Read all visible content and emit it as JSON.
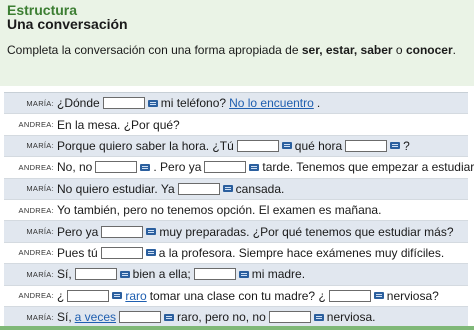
{
  "header": {
    "section_title": "Estructura",
    "subtitle": "Una conversación",
    "instructions": [
      {
        "text": "Completa la conversación con una forma apropiada de ",
        "bold": false
      },
      {
        "text": "ser, estar, saber",
        "bold": true
      },
      {
        "text": " o ",
        "bold": false
      },
      {
        "text": "conocer",
        "bold": true
      },
      {
        "text": ".",
        "bold": false
      }
    ]
  },
  "rows": [
    {
      "speaker": "MARÍA:",
      "parts": [
        {
          "t": "text",
          "v": "¿Dónde"
        },
        {
          "t": "blank",
          "w": 42
        },
        {
          "t": "kbd"
        },
        {
          "t": "text",
          "v": "mi teléfono?"
        },
        {
          "t": "answer",
          "v": "No lo encuentro"
        },
        {
          "t": "text",
          "v": "."
        }
      ]
    },
    {
      "speaker": "ANDREA:",
      "parts": [
        {
          "t": "text",
          "v": "En la mesa. ¿Por qué?"
        }
      ]
    },
    {
      "speaker": "MARÍA:",
      "parts": [
        {
          "t": "text",
          "v": "Porque quiero saber la hora. ¿Tú"
        },
        {
          "t": "blank",
          "w": 42
        },
        {
          "t": "kbd"
        },
        {
          "t": "text",
          "v": "qué hora"
        },
        {
          "t": "blank",
          "w": 42
        },
        {
          "t": "kbd"
        },
        {
          "t": "text",
          "v": "?"
        }
      ]
    },
    {
      "speaker": "ANDREA:",
      "parts": [
        {
          "t": "text",
          "v": "No, no"
        },
        {
          "t": "blank",
          "w": 42
        },
        {
          "t": "kbd"
        },
        {
          "t": "text",
          "v": ". Pero ya"
        },
        {
          "t": "blank",
          "w": 42
        },
        {
          "t": "kbd"
        },
        {
          "t": "text",
          "v": "tarde. Tenemos que empezar a estudiar."
        }
      ]
    },
    {
      "speaker": "MARÍA:",
      "parts": [
        {
          "t": "text",
          "v": "No quiero estudiar. Ya"
        },
        {
          "t": "blank",
          "w": 42
        },
        {
          "t": "kbd"
        },
        {
          "t": "text",
          "v": "cansada."
        }
      ]
    },
    {
      "speaker": "ANDREA:",
      "parts": [
        {
          "t": "text",
          "v": "Yo también, pero no tenemos opción. El examen es mañana."
        }
      ]
    },
    {
      "speaker": "MARÍA:",
      "parts": [
        {
          "t": "text",
          "v": "Pero ya"
        },
        {
          "t": "blank",
          "w": 42
        },
        {
          "t": "kbd"
        },
        {
          "t": "text",
          "v": "muy preparadas. ¿Por qué tenemos que estudiar más?"
        }
      ]
    },
    {
      "speaker": "ANDREA:",
      "parts": [
        {
          "t": "text",
          "v": "Pues tú"
        },
        {
          "t": "blank",
          "w": 42
        },
        {
          "t": "kbd"
        },
        {
          "t": "text",
          "v": "a la profesora. Siempre hace exámenes muy difíciles."
        }
      ]
    },
    {
      "speaker": "MARÍA:",
      "parts": [
        {
          "t": "text",
          "v": "Sí,"
        },
        {
          "t": "blank",
          "w": 42
        },
        {
          "t": "kbd"
        },
        {
          "t": "text",
          "v": "bien a ella;"
        },
        {
          "t": "blank",
          "w": 42
        },
        {
          "t": "kbd"
        },
        {
          "t": "text",
          "v": "mi madre."
        }
      ]
    },
    {
      "speaker": "ANDREA:",
      "parts": [
        {
          "t": "text",
          "v": "¿"
        },
        {
          "t": "blank",
          "w": 42
        },
        {
          "t": "kbd"
        },
        {
          "t": "answer",
          "v": "raro"
        },
        {
          "t": "text",
          "v": "tomar una clase con tu madre? ¿"
        },
        {
          "t": "blank",
          "w": 42
        },
        {
          "t": "kbd"
        },
        {
          "t": "text",
          "v": "nerviosa?"
        }
      ]
    },
    {
      "speaker": "MARÍA:",
      "parts": [
        {
          "t": "text",
          "v": "Sí,"
        },
        {
          "t": "answer",
          "v": "a veces"
        },
        {
          "t": "blank",
          "w": 42
        },
        {
          "t": "kbd"
        },
        {
          "t": "text",
          "v": "raro, pero no, no"
        },
        {
          "t": "blank",
          "w": 42
        },
        {
          "t": "kbd"
        },
        {
          "t": "text",
          "v": "nerviosa."
        }
      ]
    }
  ]
}
